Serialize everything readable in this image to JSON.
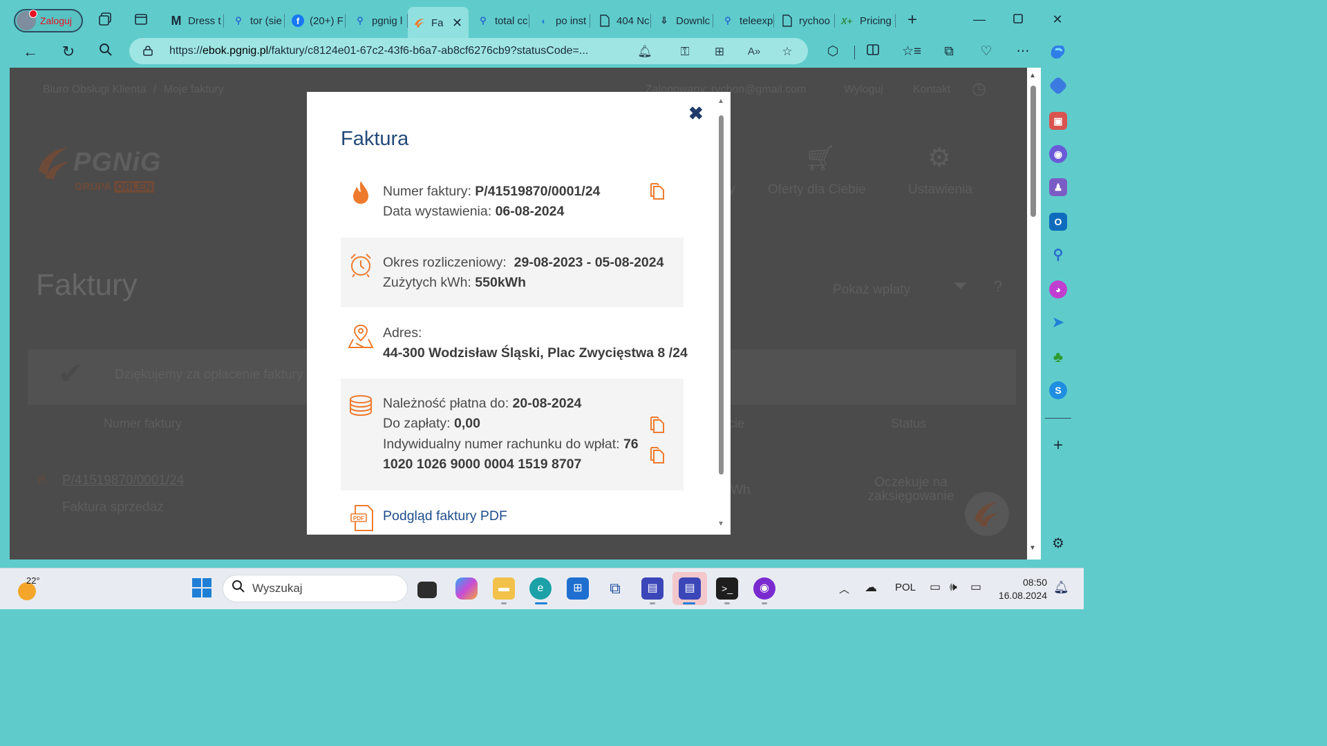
{
  "browser": {
    "profile_label": "Zaloguj",
    "tabs": [
      {
        "title": "Dress t",
        "fav": "M"
      },
      {
        "title": "tor (sie",
        "fav": "search"
      },
      {
        "title": "(20+) F",
        "fav": "facebook"
      },
      {
        "title": "pgnig l",
        "fav": "search"
      },
      {
        "title": "Fa",
        "fav": "pgnig",
        "active": true
      },
      {
        "title": "total cc",
        "fav": "search"
      },
      {
        "title": "po inst",
        "fav": "edge"
      },
      {
        "title": "404 Nc",
        "fav": "doc"
      },
      {
        "title": "Downlc",
        "fav": "download"
      },
      {
        "title": "teleexp",
        "fav": "search"
      },
      {
        "title": "rychoo",
        "fav": "doc"
      },
      {
        "title": "Pricing",
        "fav": "x-plus"
      }
    ],
    "url_prefix": "https://",
    "url_domain": "ebok.pgnig.pl",
    "url_path": "/faktury/c8124e01-67c2-43f6-b6a7-ab8cf6276cb9?statusCode=..."
  },
  "page": {
    "breadcrumb_home": "Biuro Obsługi Klienta",
    "breadcrumb_sep": "/",
    "breadcrumb_current": "Moje faktury",
    "logged_in": "Zalogowany: rychon@gmail.com",
    "logout": "Wyloguj",
    "contact": "Kontakt",
    "logo_text": "PGNiG",
    "logo_sub_1": "GRUPA",
    "logo_sub_2": "ORLEN",
    "nav_partial": "y",
    "nav_offers": "Oferty dla Ciebie",
    "nav_settings": "Ustawienia",
    "heading": "Faktury",
    "show_payments": "Pokaż wpłaty",
    "help": "?",
    "thanks": "Dziękujemy za opłacenie faktury",
    "col_invoice_number": "Numer faktury",
    "col_partial": "cie",
    "col_status": "Status",
    "row_invoice_number": "P/41519870/0001/24",
    "row_invoice_type": "Faktura sprzedaz",
    "row_partial_unit": "Wh",
    "row_status": "Oczekuje na zaksięgowanie"
  },
  "modal": {
    "title": "Faktura",
    "invoice_number_label": "Numer faktury:",
    "invoice_number": "P/41519870/0001/24",
    "issue_date_label": "Data wystawienia:",
    "issue_date": "06-08-2024",
    "period_label": "Okres rozliczeniowy:",
    "period": "29-08-2023 - 05-08-2024",
    "kwh_label": "Zużytych kWh:",
    "kwh": "550kWh",
    "address_label": "Adres:",
    "address": "44-300 Wodzisław Śląski, Plac Zwycięstwa 8 /24",
    "due_label": "Należność płatna do:",
    "due_date": "20-08-2024",
    "to_pay_label": "Do zapłaty:",
    "to_pay": "0,00",
    "account_label": "Indywidualny numer rachunku do wpłat:",
    "account_part1": "76",
    "account_part2": "1020 1026 9000 0004 1519 8707",
    "pdf_link": "Podgląd faktury PDF"
  },
  "taskbar": {
    "temperature": "22°",
    "search_placeholder": "Wyszukaj",
    "language": "POL",
    "time": "08:50",
    "date": "16.08.2024"
  },
  "colors": {
    "accent_orange": "#ee7b2d",
    "modal_title": "#234a7a",
    "browser_chrome": "#5fcccb"
  }
}
